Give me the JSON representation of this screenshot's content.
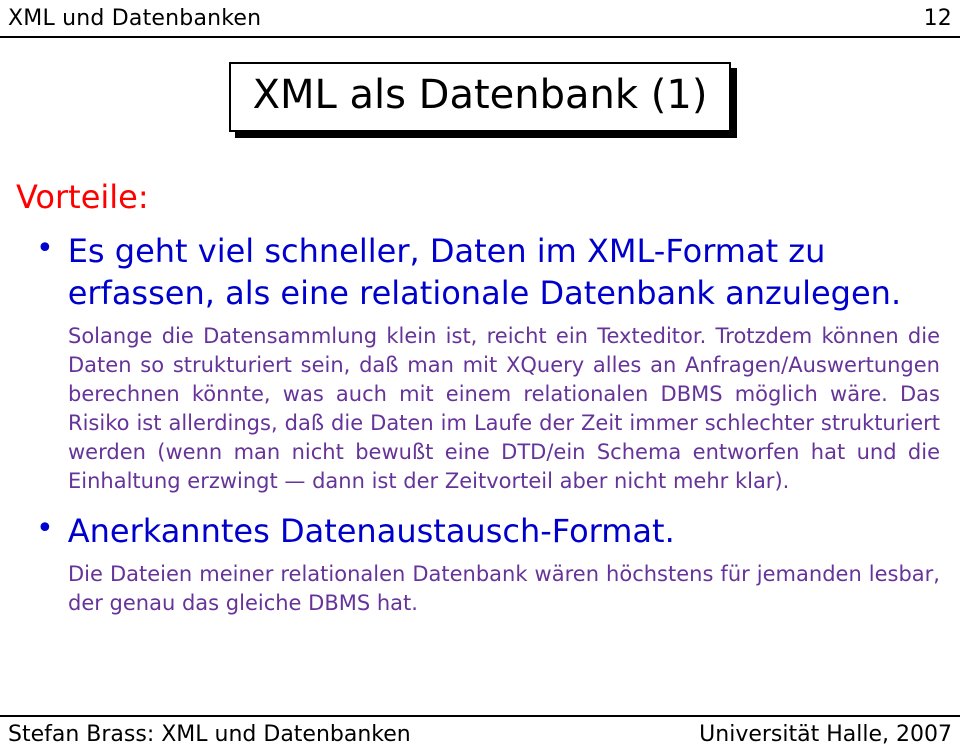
{
  "header": {
    "left": "XML und Datenbanken",
    "right": "12"
  },
  "title": "XML als Datenbank (1)",
  "section_label": "Vorteile:",
  "bullets": [
    {
      "text": "Es geht viel schneller, Daten im XML-Format zu erfassen, als eine relationale Datenbank anzulegen.",
      "sub": "Solange die Datensammlung klein ist, reicht ein Texteditor. Trotzdem können die Daten so strukturiert sein, daß man mit XQuery alles an Anfragen/Auswertungen berechnen könnte, was auch mit einem relationalen DBMS möglich wäre. Das Risiko ist allerdings, daß die Daten im Laufe der Zeit immer schlechter strukturiert werden (wenn man nicht bewußt eine DTD/ein Schema entworfen hat und die Einhaltung erzwingt — dann ist der Zeitvorteil aber nicht mehr klar)."
    },
    {
      "text": "Anerkanntes Datenaustausch-Format.",
      "sub": "Die Dateien meiner relationalen Datenbank wären höchstens für jemanden lesbar, der genau das gleiche DBMS hat."
    }
  ],
  "footer": {
    "left": "Stefan Brass: XML und Datenbanken",
    "right": "Universität Halle, 2007"
  },
  "bullet_marker": "•"
}
